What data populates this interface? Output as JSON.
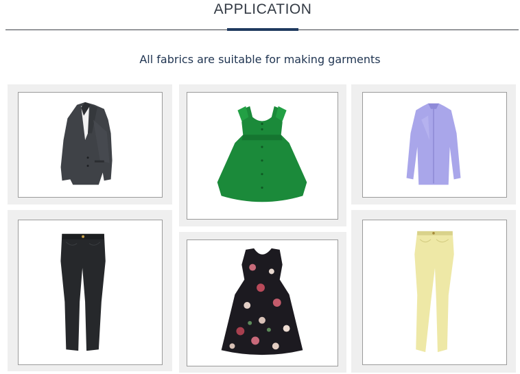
{
  "section": {
    "title": "APPLICATION",
    "subtitle": "All fabrics are suitable for making garments"
  },
  "colors": {
    "accent": "#1f3a5f",
    "card_background": "#efefef",
    "frame_border": "#9a9a9a"
  },
  "gallery": [
    {
      "item": "blazer-image"
    },
    {
      "item": "green-dress-image"
    },
    {
      "item": "lavender-shirt-image"
    },
    {
      "item": "black-trousers-image"
    },
    {
      "item": "floral-dress-image"
    },
    {
      "item": "yellow-jeans-image"
    }
  ]
}
